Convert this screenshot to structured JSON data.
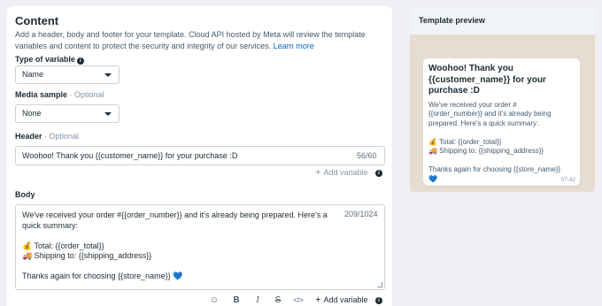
{
  "content": {
    "title": "Content",
    "description": "Add a header, body and footer for your template. Cloud API hosted by Meta will review the template variables and content to protect the security and integrity of our services.",
    "learn_more": "Learn more"
  },
  "type_of_variable": {
    "label": "Type of variable",
    "value": "Name"
  },
  "media_sample": {
    "label": "Media sample",
    "optional": "· Optional",
    "value": "None"
  },
  "header": {
    "label": "Header",
    "optional": "· Optional",
    "value": "Woohoo! Thank you {{customer_name}} for your purchase :D",
    "counter": "56/60",
    "add_variable": "Add variable"
  },
  "body": {
    "label": "Body",
    "line1": "We've received your order #{{order_number}} and it's already being prepared. Here's a quick summary:",
    "line2": "💰 Total: {{order_total}}",
    "line3": "🚚 Shipping to: {{shipping_address}}",
    "line4": "Thanks again for choosing {{store_name}} 💙",
    "counter": "209/1024",
    "add_variable": "Add variable"
  },
  "toolbar": {
    "emoji": "☺",
    "bold": "B",
    "italic": "I",
    "strike": "S",
    "code": "</>"
  },
  "preview": {
    "title": "Template preview",
    "header": "Woohoo! Thank you {{customer_name}} for your purchase :D",
    "body1": "We've received your order #",
    "body2": "{{order_number}} and it's already being",
    "body3": "prepared. Here's a quick summary:",
    "body4": "💰 Total: {{order_total}}",
    "body5": "🚚 Shipping to: {{shipping_address}}",
    "body6": "Thanks again for choosing {{store_name}}",
    "body7": "💙",
    "time": "07:42"
  },
  "icons": {
    "plus": "+",
    "info": "i"
  }
}
